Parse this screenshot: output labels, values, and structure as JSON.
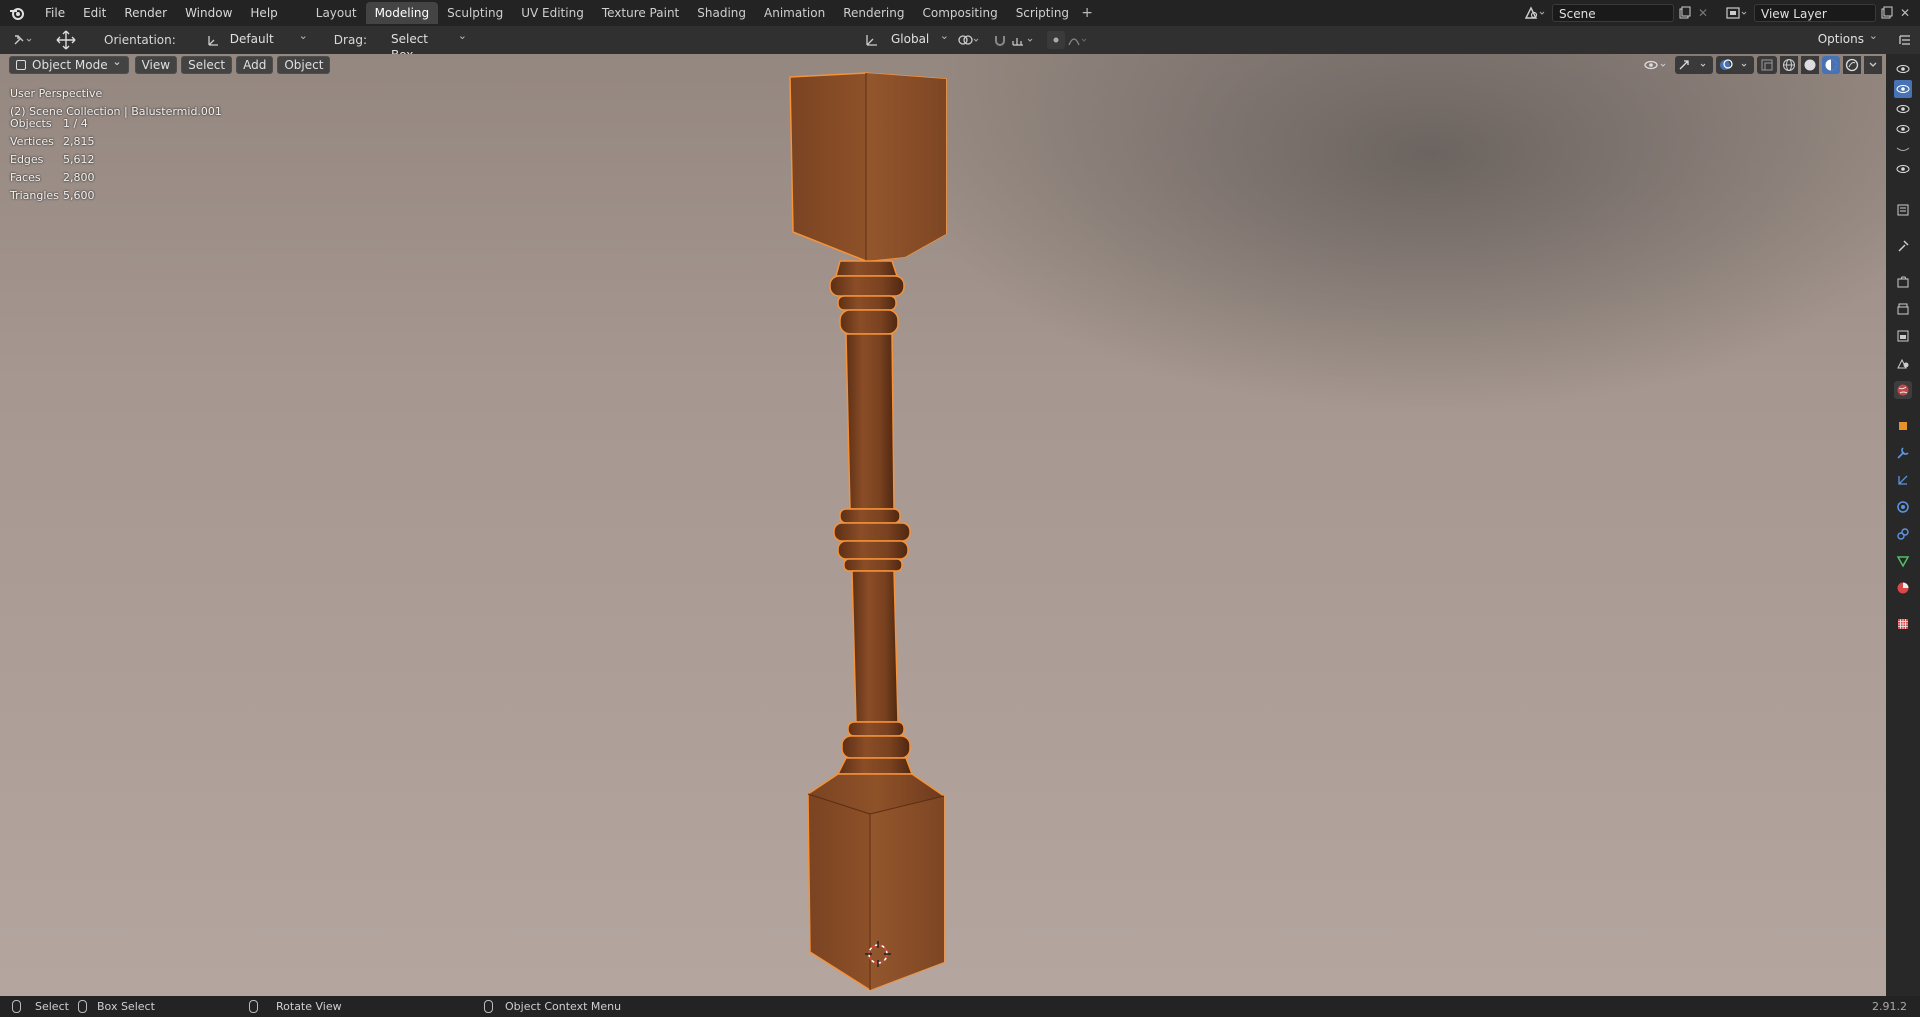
{
  "menu": [
    "File",
    "Edit",
    "Render",
    "Window",
    "Help"
  ],
  "workspace_tabs": [
    "Layout",
    "Modeling",
    "Sculpting",
    "UV Editing",
    "Texture Paint",
    "Shading",
    "Animation",
    "Rendering",
    "Compositing",
    "Scripting"
  ],
  "active_tab": "Modeling",
  "scene_name": "Scene",
  "view_layer_name": "View Layer",
  "tool_header": {
    "orientation_label": "Orientation:",
    "orientation_value": "Default",
    "drag_label": "Drag:",
    "drag_value": "Select Box",
    "transform_orientation": "Global",
    "options_label": "Options"
  },
  "viewport_header": {
    "mode": "Object Mode",
    "buttons": [
      "View",
      "Select",
      "Add",
      "Object"
    ]
  },
  "overlay": {
    "perspective": "User Perspective",
    "collection": "(2) Scene Collection | Balustermid.001",
    "stats": [
      {
        "label": "Objects",
        "value": "1 / 4"
      },
      {
        "label": "Vertices",
        "value": "2,815"
      },
      {
        "label": "Edges",
        "value": "5,612"
      },
      {
        "label": "Faces",
        "value": "2,800"
      },
      {
        "label": "Triangles",
        "value": "5,600"
      }
    ]
  },
  "statusbar": {
    "select": "Select",
    "box_select": "Box Select",
    "rotate_view": "Rotate View",
    "context_menu": "Object Context Menu",
    "version": "2.91.2"
  },
  "colors": {
    "accent": "#4772b3",
    "selection_outline": "#f5923a",
    "wood_dark": "#6b3a1f",
    "wood_light": "#9a5a30"
  }
}
